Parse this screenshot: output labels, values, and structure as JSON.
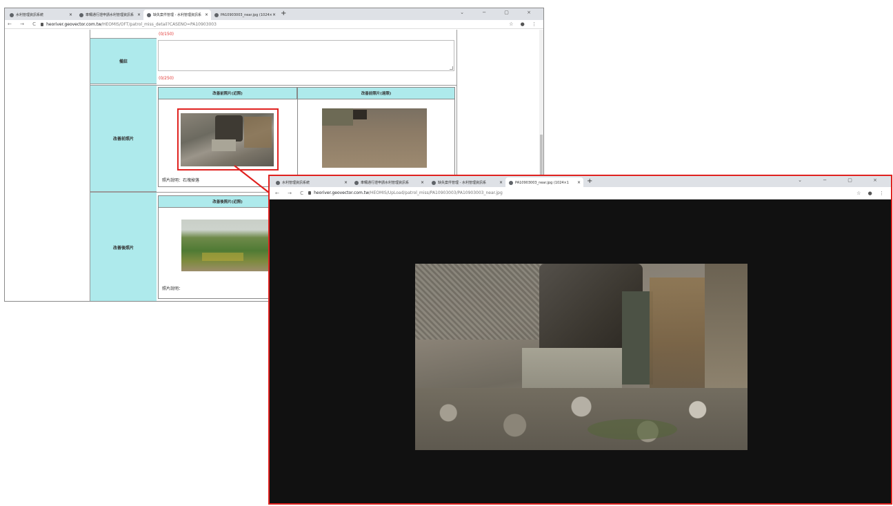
{
  "back_window": {
    "tabs": [
      {
        "label": "水利管理資訊系統"
      },
      {
        "label": "車輛通行證申請水利管理資訊系"
      },
      {
        "label": "缺失案件管理 - 水利管理資訊系"
      },
      {
        "label": "PA10903003_near.jpg (1024×"
      }
    ],
    "url_host": "heoriver.geovector.com.tw",
    "url_path": "/HEOMIS/OFT/patrol_miss_detail?CASENO=PA10903003",
    "counter_top": "(0/150)",
    "remark_label": "備註",
    "remark_counter": "(0/250)",
    "before_label": "改善前照片",
    "before_near_header": "改善前照片(近照)",
    "before_far_header": "改善前照片(遠照)",
    "before_caption": "照片說明：石塊掉落",
    "after_label": "改善後照片",
    "after_near_header": "改善後照片(近照)",
    "after_caption": "照片說明："
  },
  "front_window": {
    "tabs": [
      {
        "label": "水利管理資訊系統"
      },
      {
        "label": "車輛通行證申請水利管理資訊系"
      },
      {
        "label": "缺失案件管理 - 水利管理資訊系"
      },
      {
        "label": "PA10903003_near.jpg (1024×1"
      }
    ],
    "url_host": "heoriver.geovector.com.tw",
    "url_path": "/HEOMIS/UpLoad/patrol_miss/PA10903003/PA10903003_near.jpg"
  },
  "colors": {
    "highlight": "#e0211f",
    "label_bg": "#aeeaec",
    "viewer_bg": "#111111"
  }
}
